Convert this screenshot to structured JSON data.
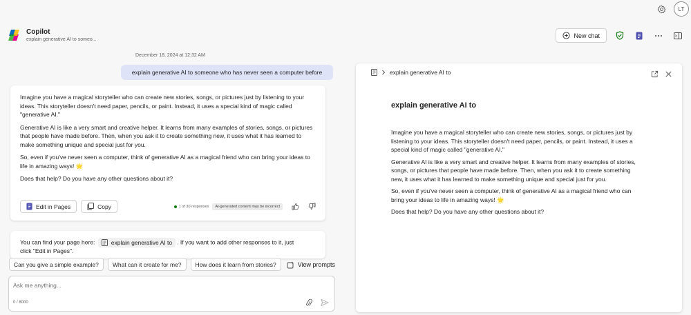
{
  "topbar": {
    "settings_icon": "gear-icon",
    "avatar_initials": "LT"
  },
  "header": {
    "title": "Copilot",
    "subtitle": "explain generative AI to someo...",
    "new_chat_label": "New chat"
  },
  "conversation": {
    "timestamp": "December 18, 2024 at 12:32 AM",
    "user_message": "explain generative AI to someone who has never seen a computer before",
    "ai_paragraphs": [
      "Imagine you have a magical storyteller who can create new stories, songs, or pictures just by listening to your ideas. This storyteller doesn't need paper, pencils, or paint. Instead, it uses a special kind of magic called \"generative AI.\"",
      "Generative AI is like a very smart and creative helper. It learns from many examples of stories, songs, or pictures that people have made before. Then, when you ask it to create something new, it uses what it has learned to make something unique and special just for you.",
      "So, even if you've never seen a computer, think of generative AI as a magical friend who can bring your ideas to life in amazing ways! 🌟",
      "Does that help? Do you have any other questions about it?"
    ],
    "edit_in_pages_label": "Edit in Pages",
    "copy_label": "Copy",
    "responses_count": "1 of 30 responses",
    "ai_disclaimer": "AI-generated content may be incorrect",
    "second_message": {
      "before": "You can find your page here:",
      "page_name": "explain generative AI to",
      "after": ". If you want to add other responses to it, just",
      "line2": "click \"Edit in Pages\"."
    }
  },
  "suggestions": [
    "Can you give a simple example?",
    "What can it create for me?",
    "How does it learn from stories?"
  ],
  "view_prompts_label": "View prompts",
  "composer": {
    "placeholder": "Ask me anything...",
    "char_count": "0 / 8000"
  },
  "pages_panel": {
    "breadcrumb": "explain generative AI to",
    "title": "explain generative AI to",
    "paragraphs": [
      "Imagine you have a magical storyteller who can create new stories, songs, or pictures just by listening to your ideas. This storyteller doesn't need paper, pencils, or paint. Instead, it uses a special kind of magic called \"generative AI.\"",
      "Generative AI is like a very smart and creative helper. It learns from many examples of stories, songs, or pictures that people have made before. Then, when you ask it to create something new, it uses what it has learned to make something unique and special just for you.",
      "So, even if you've never seen a computer, think of generative AI as a magical friend who can bring your ideas to life in amazing ways! 🌟",
      "Does that help? Do you have any other questions about it?"
    ]
  },
  "colors": {
    "accent": "#5b5fc7",
    "user_bubble": "#dfe3f7",
    "shield_green": "#107c10",
    "pages_blue": "#4f52b2"
  }
}
